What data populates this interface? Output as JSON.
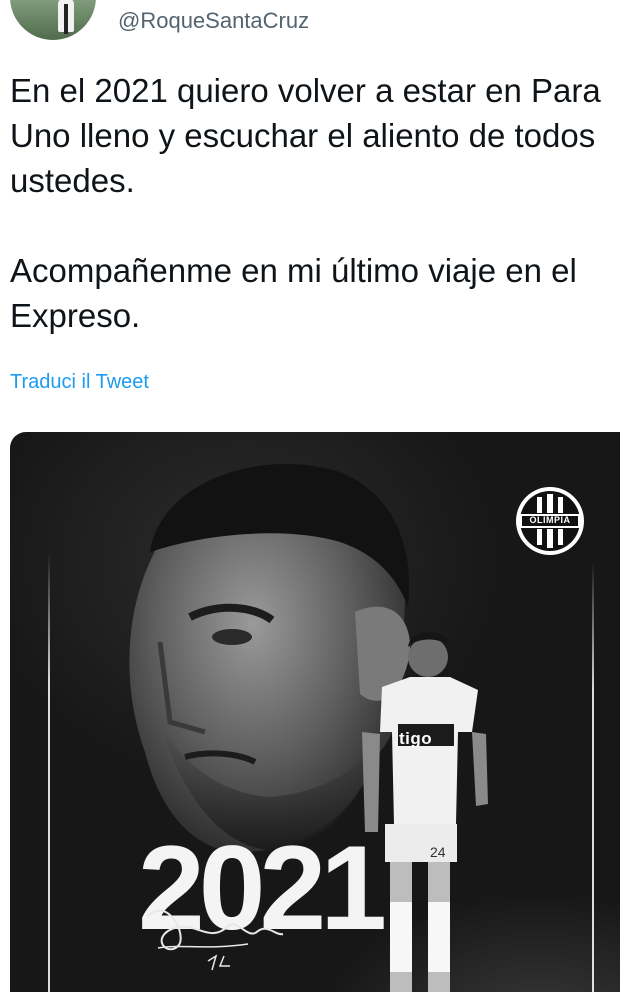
{
  "tweet": {
    "handle": "@RoqueSantaCruz",
    "text": "En el 2021 quiero volver a estar en Para Uno lleno y escuchar el aliento de todos ustedes.\n\nAcompañenme en mi último viaje en el Expreso.",
    "translate_label": "Traduci il Tweet"
  },
  "media": {
    "year": "2021",
    "crest_text": "OLIMPIA",
    "sponsor": "tigo",
    "jersey_number": "24"
  }
}
